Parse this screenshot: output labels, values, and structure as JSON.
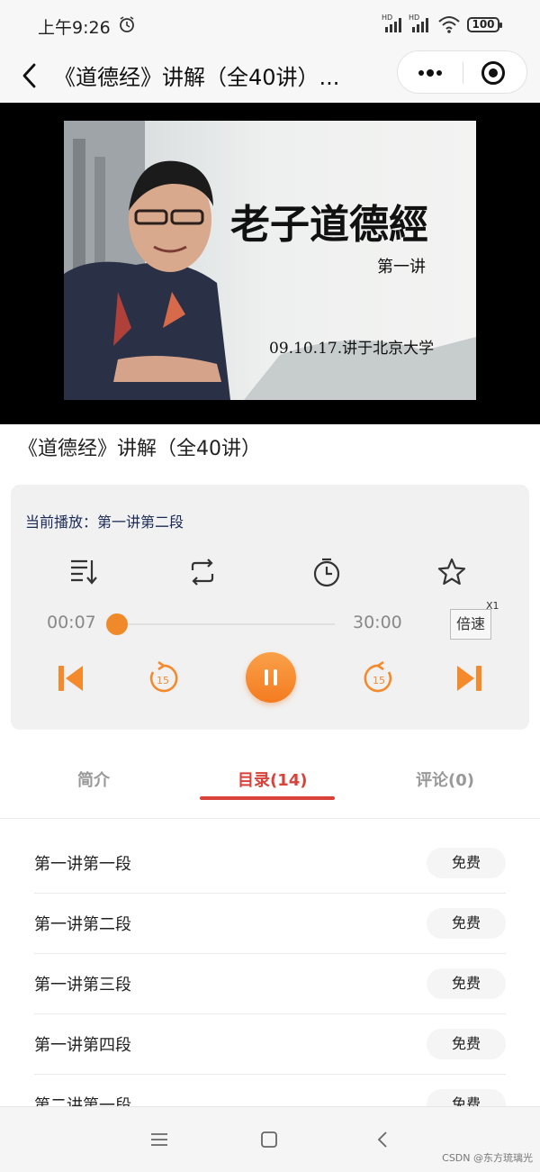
{
  "status_bar": {
    "time": "上午9:26",
    "network_label_1": "HD",
    "network_label_2": "HD",
    "battery": "100"
  },
  "header": {
    "title": "《道德经》讲解（全40讲）..."
  },
  "video": {
    "calligraphy_title": "老子道德經",
    "calligraphy_lecture": "第一讲",
    "calligraphy_caption": "09.10.17.讲于北京大学"
  },
  "course": {
    "title": "《道德经》讲解（全40讲）"
  },
  "player": {
    "now_playing": "当前播放：第一讲第二段",
    "current_time": "00:07",
    "total_time": "30:00",
    "progress_fraction": 0.0039,
    "speed_label": "倍速",
    "speed_value": "X1",
    "rewind_seconds": "15",
    "forward_seconds": "15",
    "accent_color": "#f47b20"
  },
  "tabs": [
    {
      "label": "简介",
      "active": false
    },
    {
      "label": "目录(14)",
      "active": true
    },
    {
      "label": "评论(0)",
      "active": false
    }
  ],
  "episodes": [
    {
      "title": "第一讲第一段",
      "badge": "免费"
    },
    {
      "title": "第一讲第二段",
      "badge": "免费"
    },
    {
      "title": "第一讲第三段",
      "badge": "免费"
    },
    {
      "title": "第一讲第四段",
      "badge": "免费"
    },
    {
      "title": "第二讲第一段",
      "badge": "免费"
    }
  ],
  "watermark": "CSDN @东方琉璃光"
}
